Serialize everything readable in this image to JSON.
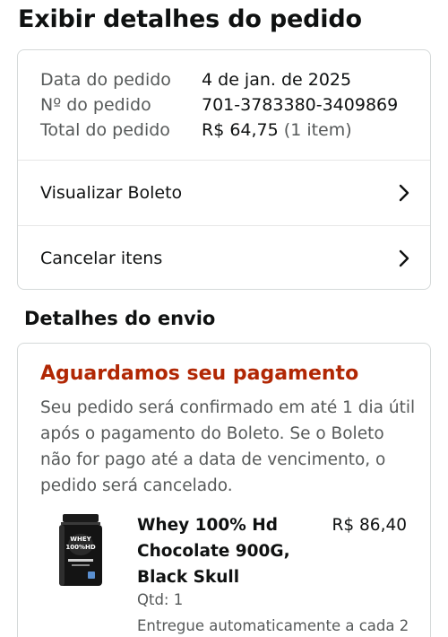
{
  "page": {
    "title": "Exibir detalhes do pedido"
  },
  "order": {
    "date_label": "Data do pedido",
    "date_value": "4 de jan. de 2025",
    "number_label": "Nº do pedido",
    "number_value": "701-3783380-3409869",
    "total_label": "Total do pedido",
    "total_value": "R$ 64,75",
    "total_items": "(1 item)"
  },
  "actions": {
    "view_boleto": "Visualizar Boleto",
    "cancel_items": "Cancelar itens",
    "chevron_icon": "chevron-right-icon"
  },
  "shipping": {
    "section_title": "Detalhes do envio",
    "status_title": "Aguardamos seu pagamento",
    "status_color": "#b12704",
    "status_message": "Seu pedido será confirmado em até 1 dia útil após o pagamento do Boleto. Se o Boleto não for pago até a data de vencimento, o pedido será cancelado.",
    "item": {
      "name": "Whey 100% Hd Chocolate 900G, Black Skull",
      "price": "R$ 86,40",
      "quantity": "Qtd: 1",
      "delivery_note": "Entregue automaticamente a cada 2",
      "image_icon": "protein-tub-image"
    }
  }
}
